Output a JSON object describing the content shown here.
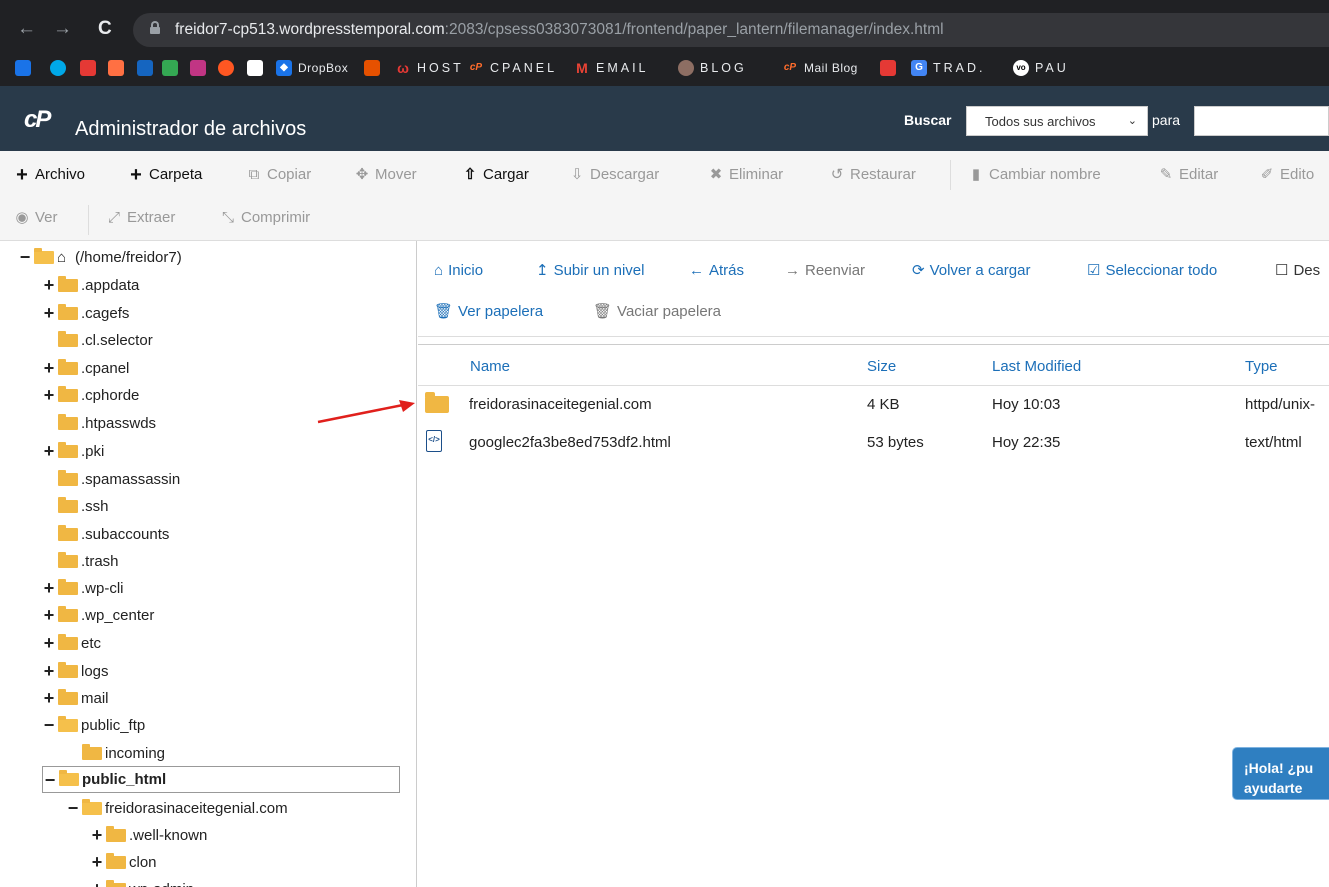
{
  "browser": {
    "back_icon": "←",
    "forward_icon": "→",
    "reload_icon": "C",
    "url_domain": "freidor7-cp513.wordpresstemporal.com",
    "url_path": ":2083/cpsess0383073081/frontend/paper_lantern/filemanager/index.html"
  },
  "bookmarks": [
    {
      "label": "DropBox",
      "color": "#1a73e8"
    },
    {
      "label": "HOST",
      "color": "#e53935"
    },
    {
      "label": "CPANEL",
      "color": "#ff6c2c"
    },
    {
      "label": "EMAIL",
      "color": "#ea4335"
    },
    {
      "label": "BLOG",
      "color": "#8d6e63"
    },
    {
      "label": "Mail Blog",
      "color": "#ff6c2c"
    },
    {
      "label": "TRAD.",
      "color": "#4285f4"
    },
    {
      "label": "PAU",
      "color": "#ffffff"
    }
  ],
  "header": {
    "logo": "cP",
    "title": "Administrador de archivos",
    "search_label": "Buscar",
    "search_scope": "Todos sus archivos",
    "para_label": "para"
  },
  "toolbar": {
    "archivo": "Archivo",
    "carpeta": "Carpeta",
    "copiar": "Copiar",
    "mover": "Mover",
    "cargar": "Cargar",
    "descargar": "Descargar",
    "eliminar": "Eliminar",
    "restaurar": "Restaurar",
    "cambiar_nombre": "Cambiar nombre",
    "editar": "Editar",
    "editor": "Edito",
    "ver": "Ver",
    "extraer": "Extraer",
    "comprimir": "Comprimir"
  },
  "tree": {
    "root": "(/home/freidor7)",
    "items": [
      ".appdata",
      ".cagefs",
      ".cl.selector",
      ".cpanel",
      ".cphorde",
      ".htpasswds",
      ".pki",
      ".spamassassin",
      ".ssh",
      ".subaccounts",
      ".trash",
      ".wp-cli",
      ".wp_center",
      "etc",
      "logs",
      "mail",
      "public_ftp",
      "incoming",
      "public_html",
      "freidorasinaceitegenial.com",
      ".well-known",
      "clon",
      "wp-admin"
    ]
  },
  "nav": {
    "inicio": "Inicio",
    "subir": "Subir un nivel",
    "atras": "Atrás",
    "reenviar": "Reenviar",
    "recargar": "Volver a cargar",
    "seleccionar": "Seleccionar todo",
    "deseleccionar": "Des",
    "ver_papelera": "Ver papelera",
    "vaciar_papelera": "Vaciar papelera"
  },
  "files": {
    "columns": {
      "name": "Name",
      "size": "Size",
      "modified": "Last Modified",
      "type": "Type"
    },
    "rows": [
      {
        "name": "freidorasinaceitegenial.com",
        "size": "4 KB",
        "modified": "Hoy 10:03",
        "type": "httpd/unix-"
      },
      {
        "name": "googlec2fa3be8ed753df2.html",
        "size": "53 bytes",
        "modified": "Hoy 22:35",
        "type": "text/html"
      }
    ]
  },
  "chat": {
    "line1": "¡Hola! ¿pu",
    "line2": "ayudarte"
  },
  "colors": {
    "header_bg": "#293a4a",
    "link_blue": "#1c6fb8",
    "folder": "#f0b743",
    "chat_bg": "#2f7fc1",
    "arrow": "#e0201c"
  }
}
